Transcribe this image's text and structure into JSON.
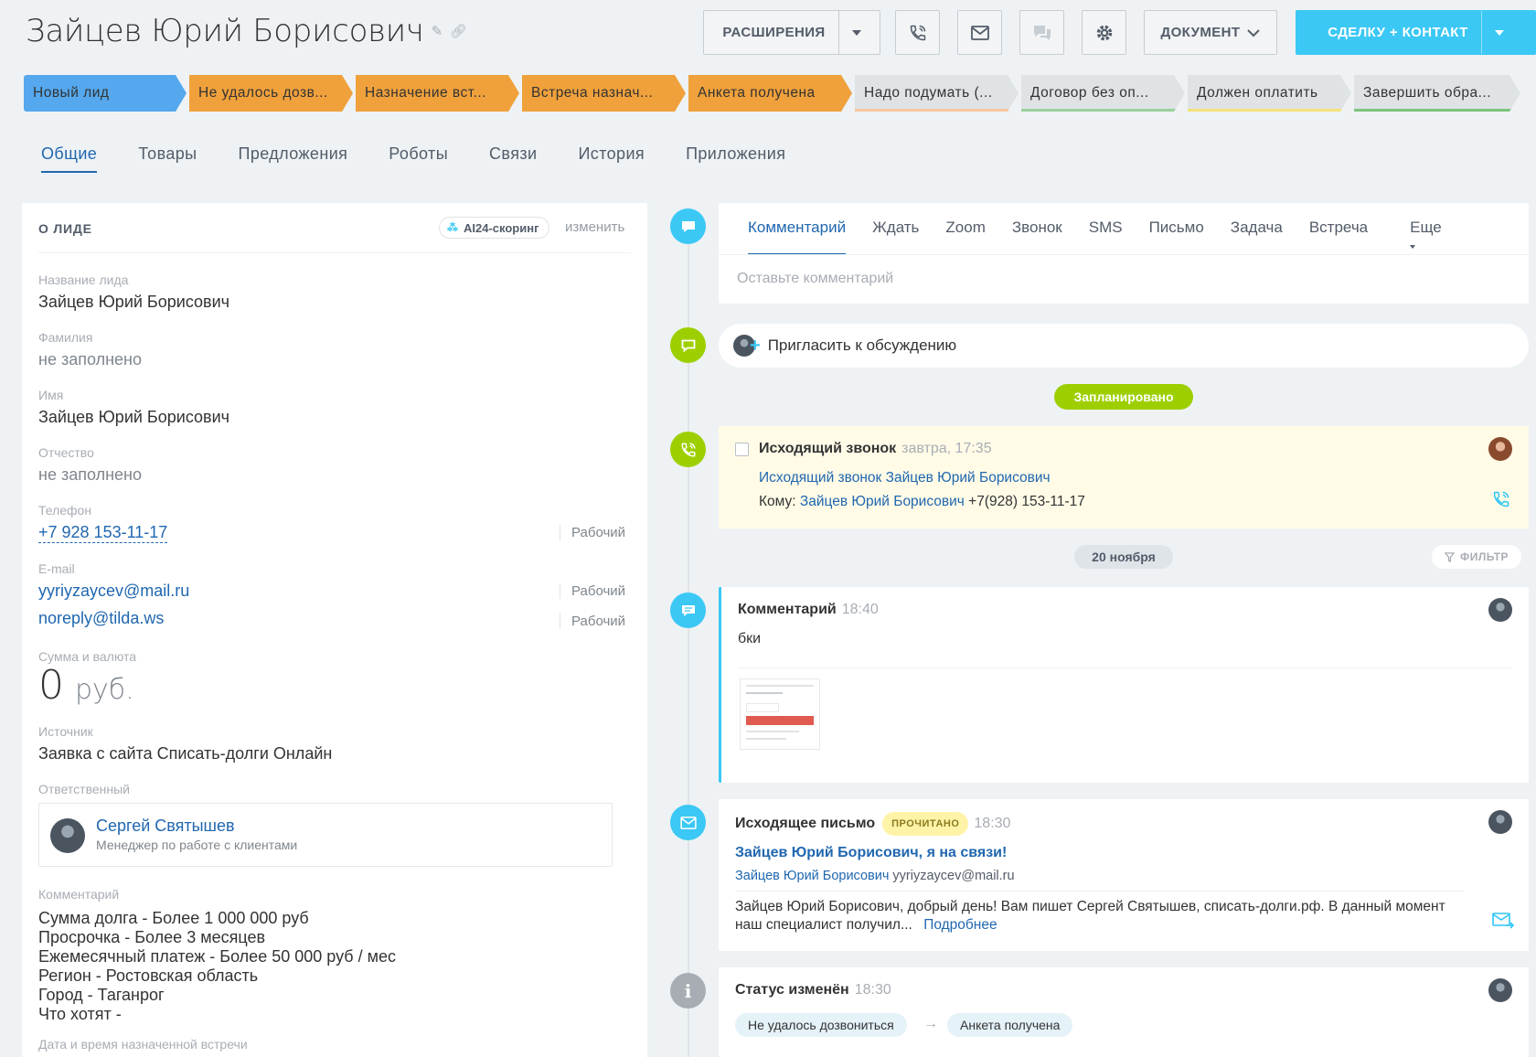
{
  "header": {
    "title": "Зайцев Юрий  Борисович",
    "buttons": {
      "extensions": "РАСШИРЕНИЯ",
      "document": "ДОКУМЕНТ",
      "deal_contact": "СДЕЛКУ + КОНТАКТ"
    }
  },
  "stages": [
    {
      "label": "Новый лид",
      "color": "#55a8ed",
      "bar": "#55a8ed"
    },
    {
      "label": "Не удалось дозв...",
      "color": "#f0a13c",
      "bar": "#f0a13c"
    },
    {
      "label": "Назначение вст...",
      "color": "#f0a13c",
      "bar": "#f0a13c"
    },
    {
      "label": "Встреча назнач...",
      "color": "#f0a13c",
      "bar": "#f0a13c"
    },
    {
      "label": "Анкета получена",
      "color": "#f0a13c",
      "bar": "#f0a13c"
    },
    {
      "label": "Надо подумать (...",
      "color": "#dfe3e6",
      "bar": "#f7c59f"
    },
    {
      "label": "Договор без оп...",
      "color": "#dfe3e6",
      "bar": "#9bd09d"
    },
    {
      "label": "Должен оплатить",
      "color": "#dfe3e6",
      "bar": "#f5e27a"
    },
    {
      "label": "Завершить обра...",
      "color": "#dfe3e6",
      "bar": "#7cc47d"
    }
  ],
  "tabs": [
    "Общие",
    "Товары",
    "Предложения",
    "Роботы",
    "Связи",
    "История",
    "Приложения"
  ],
  "left": {
    "heading": "О ЛИДЕ",
    "ai_badge": "AI24-скоринг",
    "change": "изменить",
    "fields": {
      "lead_name": {
        "label": "Название лида",
        "value": "Зайцев Юрий Борисович"
      },
      "last_name": {
        "label": "Фамилия",
        "value": "не заполнено"
      },
      "first_name": {
        "label": "Имя",
        "value": "Зайцев Юрий Борисович"
      },
      "patronymic": {
        "label": "Отчество",
        "value": "не заполнено"
      },
      "phone": {
        "label": "Телефон",
        "value": "+7 928 153-11-17",
        "type": "Рабочий"
      },
      "email": {
        "label": "E-mail",
        "values": [
          "yyriyzaycev@mail.ru",
          "noreply@tilda.ws"
        ],
        "type": "Рабочий"
      },
      "sum": {
        "label": "Сумма и валюта",
        "value": "0",
        "currency": "руб."
      },
      "source": {
        "label": "Источник",
        "value": "Заявка с сайта Списать-долги Онлайн"
      },
      "responsible": {
        "label": "Ответственный",
        "name": "Сергей Святышев",
        "position": "Менеджер по работе с клиентами"
      },
      "comment": {
        "label": "Комментарий",
        "lines": [
          "Сумма долга - Более 1 000 000 руб",
          "Просрочка - Более 3 месяцев",
          "Ежемесячный платеж - Более 50 000 руб / мес",
          "Регион - Ростовская область",
          "Город - Таганрог",
          "Что хотят -"
        ]
      },
      "meeting": {
        "label": "Дата и время назначенной встречи"
      }
    }
  },
  "composer": {
    "tabs": [
      "Комментарий",
      "Ждать",
      "Zoom",
      "Звонок",
      "SMS",
      "Письмо",
      "Задача",
      "Встреча",
      "Еще"
    ],
    "placeholder": "Оставьте комментарий"
  },
  "invite": "Пригласить к обсуждению",
  "planned_label": "Запланировано",
  "call": {
    "title": "Исходящий звонок",
    "time": "завтра, 17:35",
    "link": "Исходящий звонок Зайцев Юрий Борисович",
    "to_label": "Кому:",
    "to_name": "Зайцев Юрий Борисович",
    "to_phone": "+7(928) 153-11-17"
  },
  "date_label": "20 ноября",
  "filter_label": "ФИЛЬТР",
  "comment_event": {
    "title": "Комментарий",
    "time": "18:40",
    "text": "бки"
  },
  "email_event": {
    "title": "Исходящее письмо",
    "badge": "ПРОЧИТАНО",
    "time": "18:30",
    "subject": "Зайцев Юрий Борисович, я на связи!",
    "to_name": "Зайцев Юрий Борисович",
    "to_email": "yyriyzaycev@mail.ru",
    "body": "Зайцев Юрий Борисович, добрый день! Вам пишет Сергей Святышев, списать-долги.рф.  В данный момент наш специалист получил...",
    "more": "Подробнее"
  },
  "status_event": {
    "title": "Статус изменён",
    "time": "18:30",
    "from": "Не удалось дозвониться",
    "to": "Анкета получена"
  },
  "colors": {
    "accent": "#2067b0",
    "primary": "#3bc8f5",
    "green": "#9dcf00",
    "orange": "#f0a13c"
  }
}
